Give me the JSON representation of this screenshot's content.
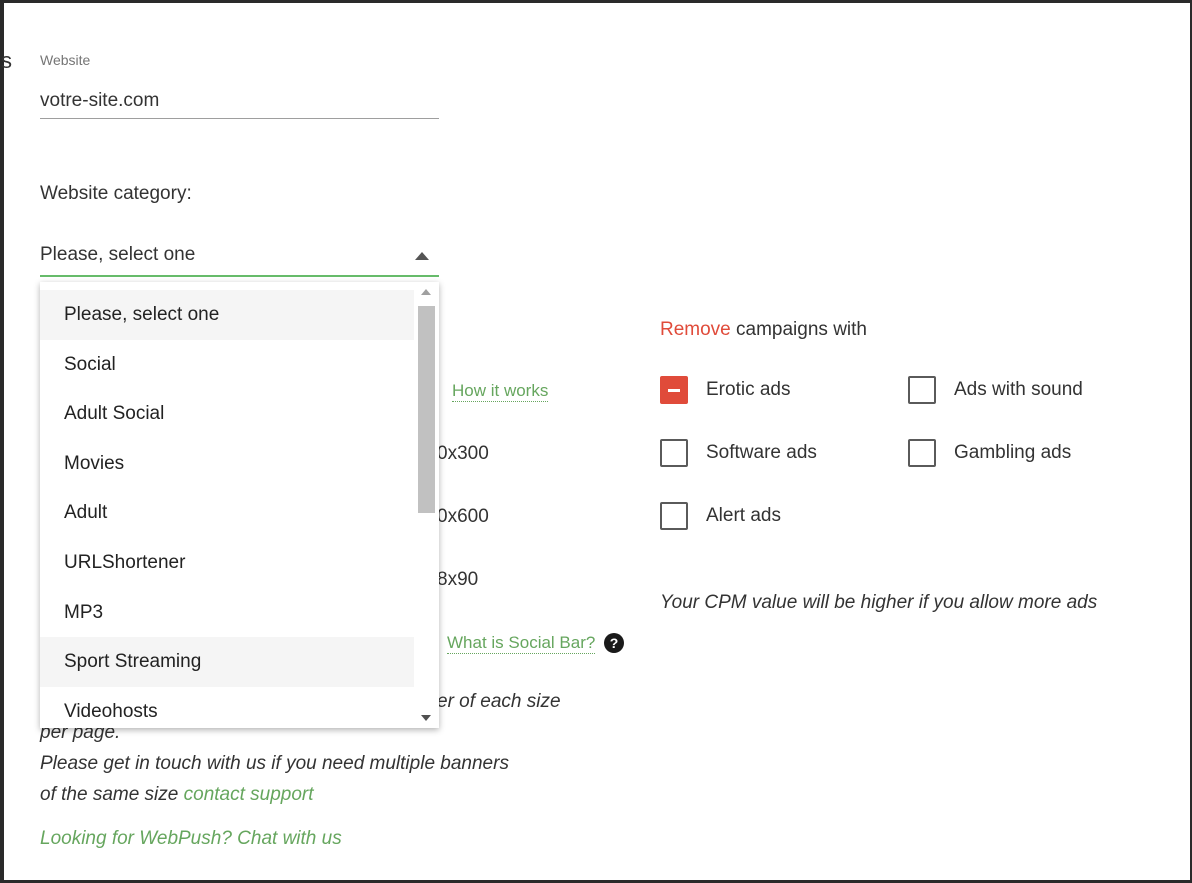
{
  "form": {
    "edge_glyph": "s",
    "website_label": "Website",
    "website_value": "votre-site.com",
    "category_label": "Website category:",
    "category_selected": "Please, select one",
    "category_options": [
      "Please, select one",
      "Social",
      "Adult Social",
      "Movies",
      "Adult",
      "URLShortener",
      "MP3",
      "Sport Streaming",
      "Videohosts"
    ],
    "highlighted_options": [
      "Please, select one",
      "Sport Streaming"
    ]
  },
  "background": {
    "how_it_works": "How it works",
    "size_1": "0x300",
    "size_2": "0x600",
    "size_3": "8x90",
    "social_bar_link": "What is Social Bar?",
    "help_icon": "?",
    "note_line1": "er of each size",
    "note_line2": "per page.",
    "note_line3": "Please get in touch with us if you need multiple banners",
    "note_line4_prefix": "of the same size",
    "contact_support": "contact support",
    "webpush": "Looking for WebPush? Chat with us"
  },
  "campaigns": {
    "title_red": "Remove",
    "title_rest": " campaigns with",
    "options": {
      "erotic": {
        "label": "Erotic ads",
        "state": "indeterminate"
      },
      "sound": {
        "label": "Ads with sound",
        "state": "unchecked"
      },
      "software": {
        "label": "Software ads",
        "state": "unchecked"
      },
      "gambling": {
        "label": "Gambling ads",
        "state": "unchecked"
      },
      "alert": {
        "label": "Alert ads",
        "state": "unchecked"
      }
    },
    "cpm_note": "Your CPM value will be higher if you allow more ads"
  },
  "colors": {
    "accent_green": "#66a65e",
    "select_underline": "#66bb6a",
    "remove_red": "#e04b3a"
  }
}
